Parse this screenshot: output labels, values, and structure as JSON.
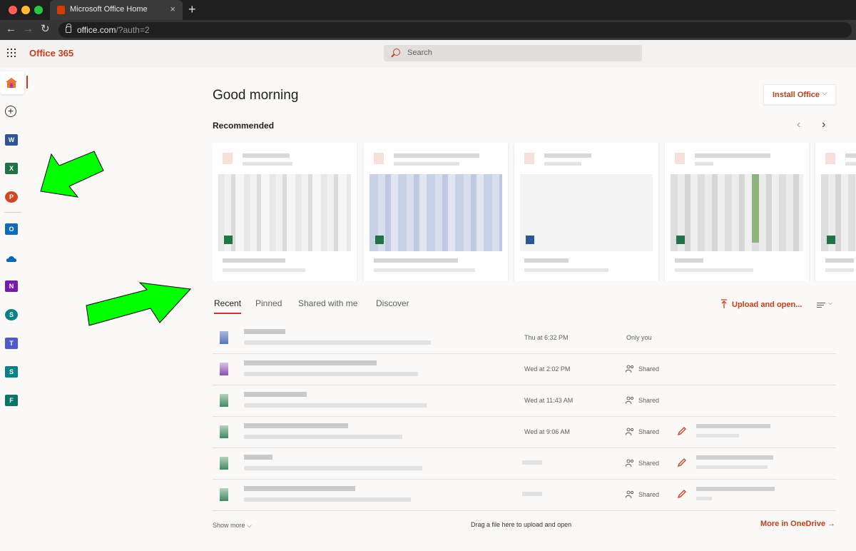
{
  "browser": {
    "tab_title": "Microsoft Office Home",
    "tab_close": "×",
    "new_tab": "+",
    "url_host": "office.com",
    "url_rest": "/?auth=2",
    "back": "←",
    "forward": "→",
    "reload": "↻"
  },
  "header": {
    "brand": "Office 365",
    "search_placeholder": "Search"
  },
  "rail": {
    "items": [
      {
        "name": "home",
        "icon": "home-icon"
      },
      {
        "name": "create",
        "icon": "plus-circle-icon",
        "glyph": "+"
      },
      {
        "name": "word",
        "icon": "word-icon",
        "letter": "W",
        "color": "#2b579a"
      },
      {
        "name": "excel",
        "icon": "excel-icon",
        "letter": "X",
        "color": "#217346"
      },
      {
        "name": "powerpoint",
        "icon": "powerpoint-icon",
        "letter": "P",
        "color": "#d24726"
      },
      {
        "name": "outlook",
        "icon": "outlook-icon",
        "letter": "O",
        "color": "#0f6cbd"
      },
      {
        "name": "onedrive",
        "icon": "onedrive-icon",
        "color": "#0364b8"
      },
      {
        "name": "onenote",
        "icon": "onenote-icon",
        "letter": "N",
        "color": "#7719aa"
      },
      {
        "name": "sharepoint",
        "icon": "sharepoint-icon",
        "letter": "S",
        "color": "#038387"
      },
      {
        "name": "teams",
        "icon": "teams-icon",
        "letter": "T",
        "color": "#5059c9"
      },
      {
        "name": "sway",
        "icon": "sway-icon",
        "letter": "S",
        "color": "#038387"
      },
      {
        "name": "forms",
        "icon": "forms-icon",
        "letter": "F",
        "color": "#077568"
      }
    ]
  },
  "main": {
    "greeting": "Good morning",
    "install_label": "Install Office",
    "install_chevron": "⌵",
    "recommended_label": "Recommended",
    "rec_prev": "‹",
    "rec_next": "›",
    "tabs": [
      "Recent",
      "Pinned",
      "Shared with me",
      "Discover"
    ],
    "upload_label": "Upload and open...",
    "files": [
      {
        "app": "word",
        "date": "Thu at 6:32 PM",
        "sharing": "Only you"
      },
      {
        "app": "onenote",
        "date": "Wed at 2:02 PM",
        "sharing": "Shared"
      },
      {
        "app": "excel",
        "date": "Wed at 11:43 AM",
        "sharing": "Shared"
      },
      {
        "app": "excel",
        "date": "Wed at 9:06 AM",
        "sharing": "Shared"
      },
      {
        "app": "excel",
        "date": "",
        "sharing": "Shared"
      },
      {
        "app": "excel",
        "date": "",
        "sharing": "Shared"
      }
    ],
    "show_more": "Show more ⌵",
    "drag_hint": "Drag a file here to upload and open",
    "more_onedrive": "More in OneDrive →"
  },
  "colors": {
    "accent": "#c43e1c",
    "annotation_arrow": "#00ff00"
  }
}
